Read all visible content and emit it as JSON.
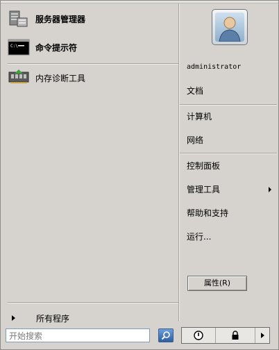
{
  "pinned": [
    {
      "label": "服务器管理器",
      "icon": "server-manager-icon"
    },
    {
      "label": "命令提示符",
      "icon": "command-prompt-icon"
    }
  ],
  "recent": [
    {
      "label": "内存诊断工具",
      "icon": "memory-diagnostic-icon"
    }
  ],
  "all_programs": {
    "label": "所有程序"
  },
  "search": {
    "placeholder": "开始搜索",
    "value": "开始搜索"
  },
  "user": {
    "name": "administrator"
  },
  "right_items": {
    "documents": "文档",
    "computer": "计算机",
    "network": "网络",
    "control_panel": "控制面板",
    "admin_tools": "管理工具",
    "help": "帮助和支持",
    "run": "运行..."
  },
  "properties_button": {
    "label": "属性(R)"
  },
  "colors": {
    "menu_bg": "#d6d3ce",
    "search_button": "#2d5ea3"
  }
}
